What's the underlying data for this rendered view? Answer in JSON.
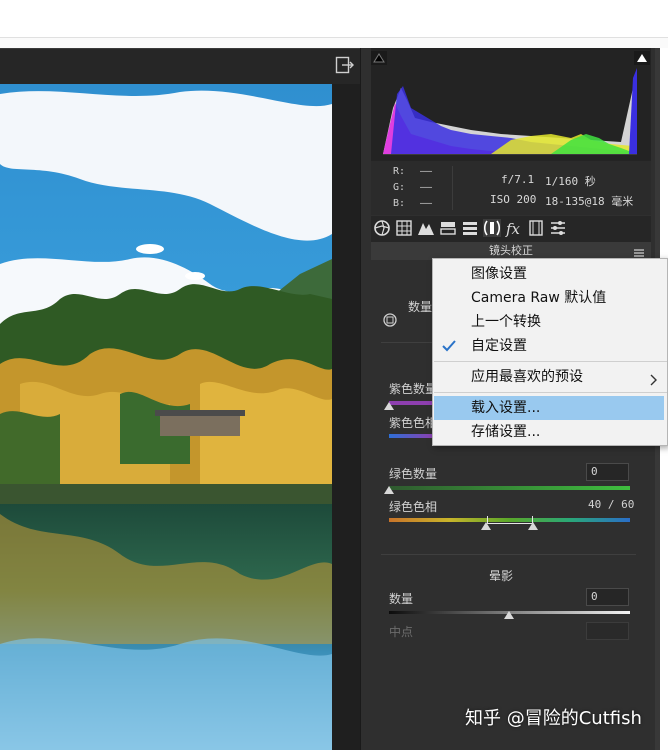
{
  "panel": {
    "section_title": "镜头校正",
    "readout": {
      "r_label": "R:",
      "g_label": "G:",
      "b_label": "B:",
      "r_value": "——",
      "g_value": "——",
      "b_value": "——",
      "aperture": "f/7.1",
      "shutter": "1/160 秒",
      "iso": "ISO 200",
      "lens": "18-135@18 毫米"
    },
    "tools": [
      "aperture-icon",
      "grid-icon",
      "mountain-icon",
      "split-icon",
      "hsl-icon",
      "lens-icon",
      "fx-icon",
      "film-icon",
      "sliders-icon"
    ],
    "defringe": {
      "amount_label": "数量",
      "purple_amount_label": "紫色数量",
      "purple_hue_label": "紫色色相",
      "green_amount_label": "绿色数量",
      "green_amount_value": "0",
      "green_hue_label": "绿色色相",
      "green_hue_value": "40 / 60",
      "green_hue_low": 40,
      "green_hue_high": 60
    },
    "vignette": {
      "title": "晕影",
      "amount_label": "数量",
      "amount_value": "0",
      "midpoint_label": "中点",
      "amount_position": 0.5
    }
  },
  "context_menu": {
    "items": [
      {
        "label": "图像设置",
        "checked": false,
        "highlighted": false
      },
      {
        "label": "Camera Raw 默认值",
        "checked": false,
        "highlighted": false
      },
      {
        "label": "上一个转换",
        "checked": false,
        "highlighted": false
      },
      {
        "label": "自定设置",
        "checked": true,
        "highlighted": false
      },
      {
        "label": "应用最喜欢的预设",
        "checked": false,
        "highlighted": false,
        "has_submenu": true
      },
      {
        "label": "载入设置...",
        "checked": false,
        "highlighted": true
      },
      {
        "label": "存储设置...",
        "checked": false,
        "highlighted": false
      }
    ]
  },
  "watermark": "知乎 @冒险的Cutfish",
  "colors": {
    "panel_bg": "#2f2f2f",
    "menu_bg": "#f2f2f2",
    "menu_highlight": "#99c9ef",
    "check_color": "#2a73c8"
  }
}
